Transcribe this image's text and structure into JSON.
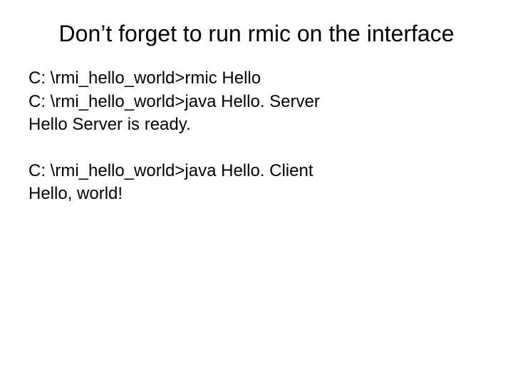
{
  "title": "Don’t forget to run rmic on the interface",
  "block1": {
    "line1": "C: \\rmi_hello_world>rmic Hello",
    "line2": "C: \\rmi_hello_world>java Hello. Server",
    "line3": "Hello Server is ready."
  },
  "block2": {
    "line1": "C: \\rmi_hello_world>java Hello. Client",
    "line2": "Hello, world!"
  }
}
